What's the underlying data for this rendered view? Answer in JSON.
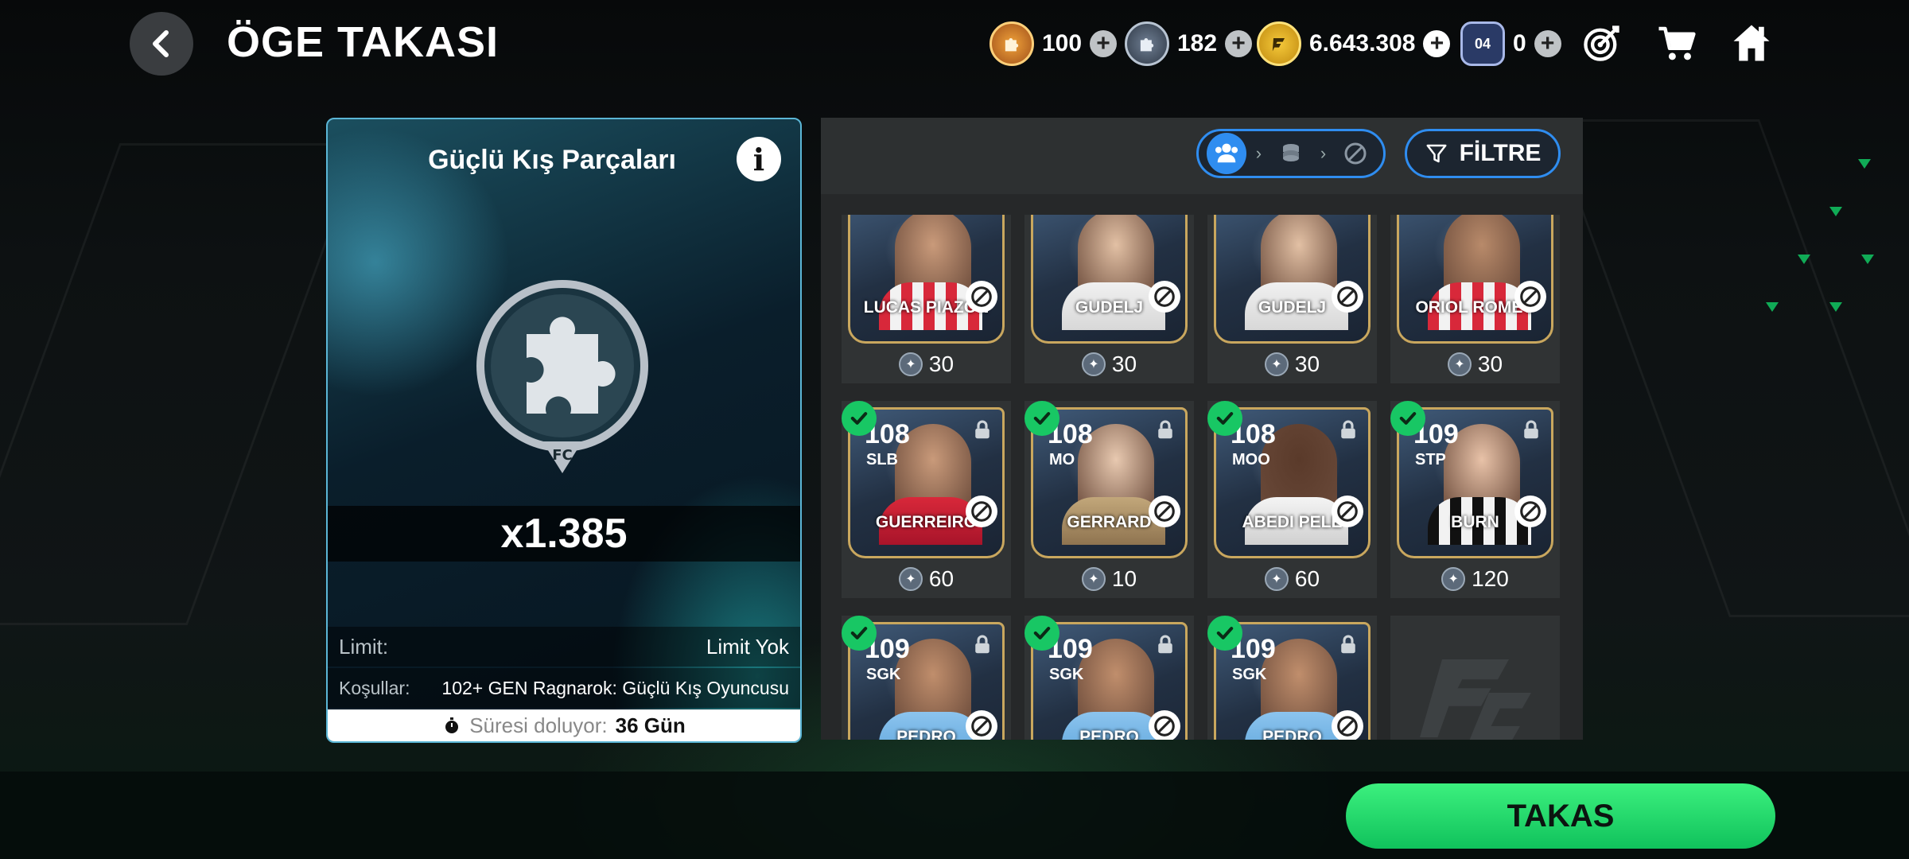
{
  "header": {
    "title": "ÖGE TAKASI",
    "currencies": [
      {
        "icon": "gold-puzzle-icon",
        "value": "100"
      },
      {
        "icon": "silver-puzzle-icon",
        "value": "182"
      },
      {
        "icon": "fc-coin-icon",
        "value": "6.643.308"
      },
      {
        "icon": "token-04-icon",
        "token_label": "04",
        "value": "0"
      }
    ]
  },
  "left_panel": {
    "title": "Güçlü Kış Parçaları",
    "quantity": "x1.385",
    "limit_label": "Limit:",
    "limit_value": "Limit Yok",
    "conditions_label": "Koşullar:",
    "conditions_value": "102+ GEN Ragnarok: Güçlü Kış Oyuncusu",
    "expiry_label": "Süresi doluyor:",
    "expiry_value": "36 Gün"
  },
  "right_panel": {
    "filter_label": "FİLTRE"
  },
  "cards": [
    {
      "name": "LUCAS PIAZÓN",
      "cost": "30",
      "rating": "",
      "position": "",
      "selected": false
    },
    {
      "name": "GUDELJ",
      "cost": "30",
      "rating": "",
      "position": "",
      "selected": false
    },
    {
      "name": "GUDELJ",
      "cost": "30",
      "rating": "",
      "position": "",
      "selected": false
    },
    {
      "name": "ORIOL ROMEU",
      "cost": "30",
      "rating": "",
      "position": "",
      "selected": false
    },
    {
      "name": "GUERREIRO",
      "cost": "60",
      "rating": "108",
      "position": "SLB",
      "selected": true
    },
    {
      "name": "GERRARD",
      "cost": "10",
      "rating": "108",
      "position": "MO",
      "selected": true
    },
    {
      "name": "ABEDI PELE",
      "cost": "60",
      "rating": "108",
      "position": "MOO",
      "selected": true
    },
    {
      "name": "BURN",
      "cost": "120",
      "rating": "109",
      "position": "STP",
      "selected": true
    },
    {
      "name": "PEDRO",
      "cost": "",
      "rating": "109",
      "position": "SGK",
      "selected": true
    },
    {
      "name": "PEDRO",
      "cost": "",
      "rating": "109",
      "position": "SGK",
      "selected": true
    },
    {
      "name": "PEDRO",
      "cost": "",
      "rating": "109",
      "position": "SGK",
      "selected": true
    }
  ],
  "action_button": "TAKAS",
  "colors": {
    "accent_green": "#18c764",
    "accent_blue": "#2f8df0",
    "panel_border": "#5bb6d6"
  }
}
